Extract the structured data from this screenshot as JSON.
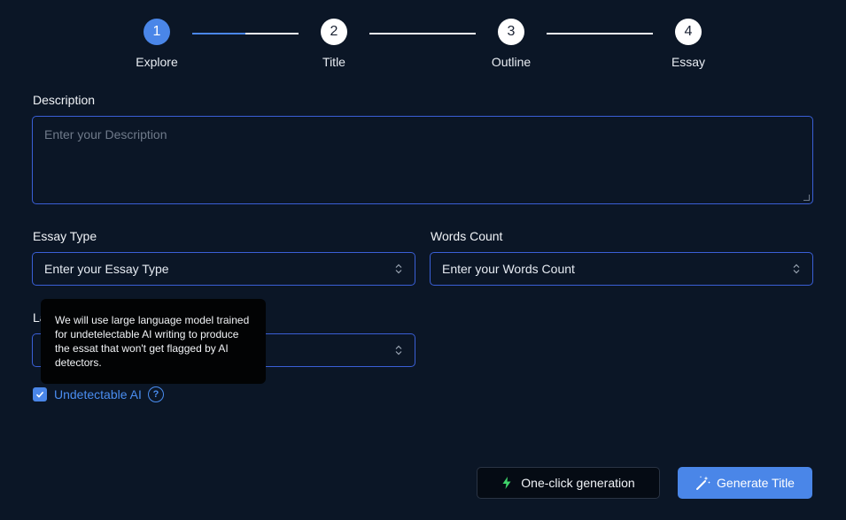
{
  "stepper": {
    "steps": [
      {
        "number": "1",
        "label": "Explore"
      },
      {
        "number": "2",
        "label": "Title"
      },
      {
        "number": "3",
        "label": "Outline"
      },
      {
        "number": "4",
        "label": "Essay"
      }
    ],
    "active_step": 1,
    "first_segment_progress": 0.5
  },
  "form": {
    "description": {
      "label": "Description",
      "placeholder": "Enter your Description"
    },
    "essay_type": {
      "label": "Essay Type",
      "value": "Enter your Essay Type"
    },
    "words_count": {
      "label": "Words Count",
      "value": "Enter your Words Count"
    },
    "language": {
      "label_visible": "La",
      "value": ""
    },
    "undetectable": {
      "label": "Undetectable AI",
      "checked": true
    }
  },
  "tooltip": {
    "text": "We will use large language model trained for undetelectable AI writing to produce the essat that won't get flagged by AI detectors."
  },
  "actions": {
    "one_click_label": "One-click generation",
    "generate_label": "Generate Title"
  },
  "colors": {
    "background": "#0b1626",
    "accent": "#4a86e8",
    "border": "#3a5fd6",
    "link": "#4a8df0"
  }
}
